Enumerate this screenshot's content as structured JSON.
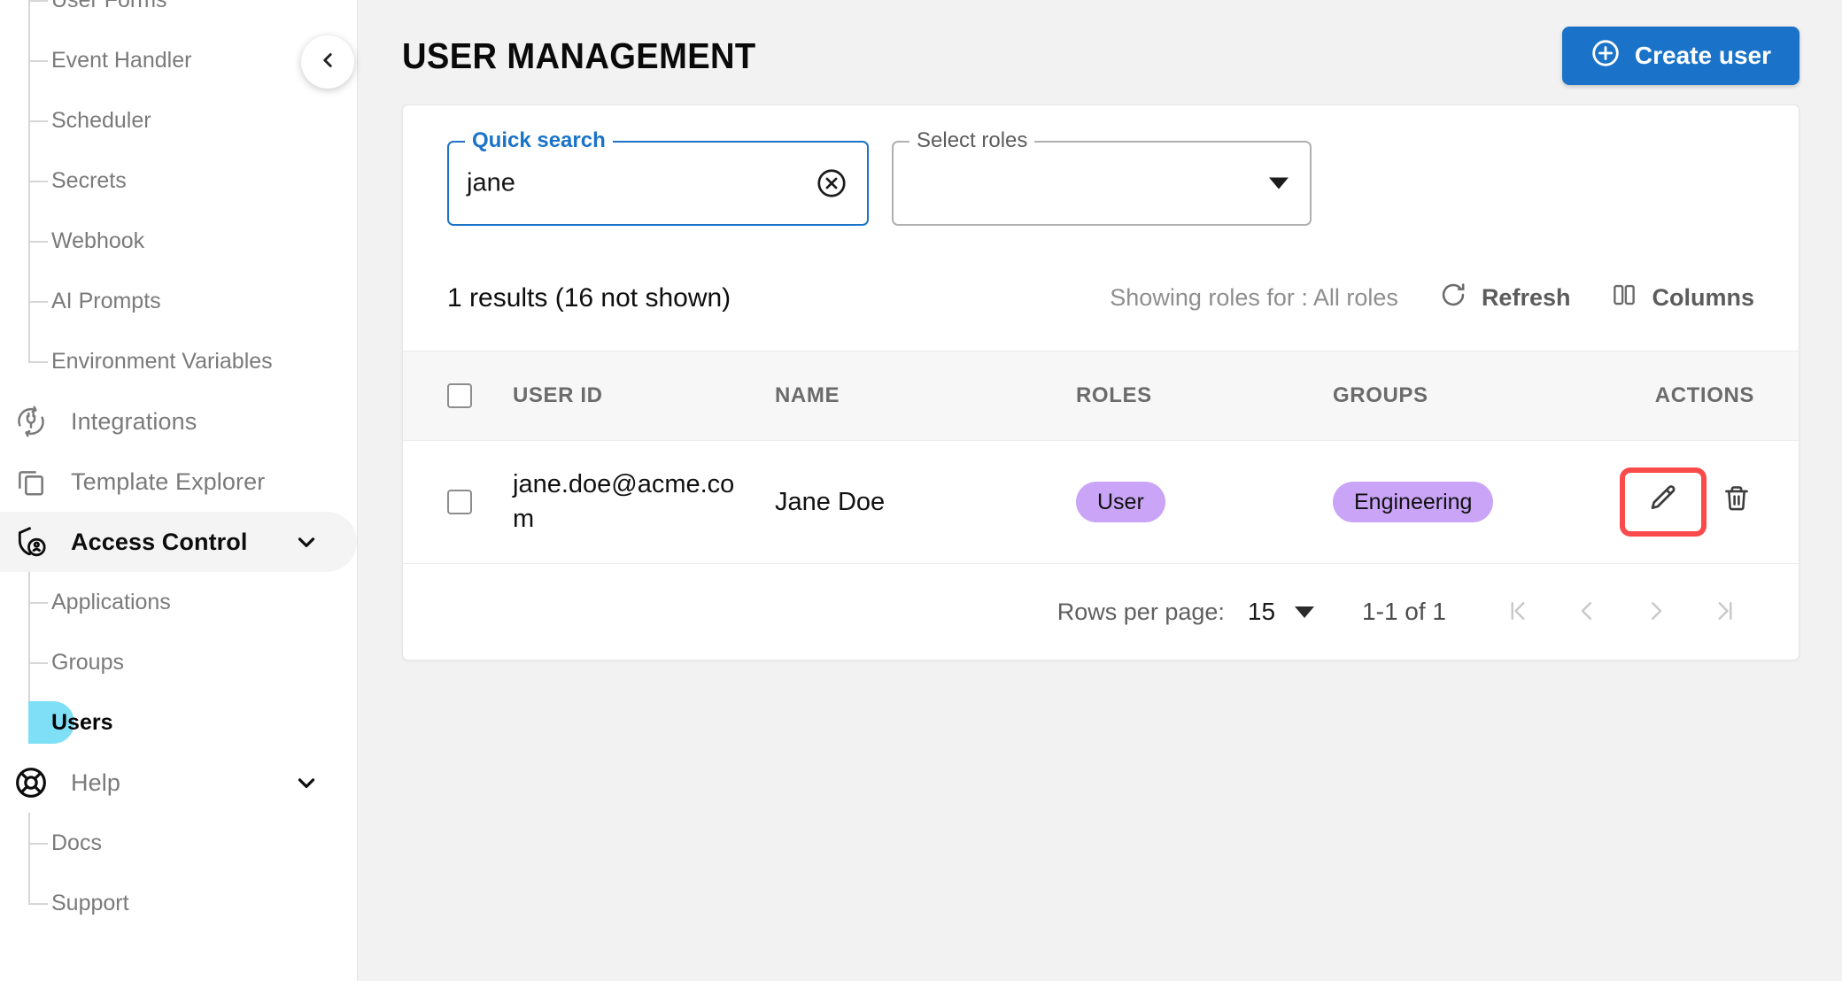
{
  "sidebar": {
    "collapse_button_icon": "chevron-left-icon",
    "items": [
      {
        "label": "User Forms",
        "type": "child",
        "state": "normal",
        "partial": true
      },
      {
        "label": "Event Handler",
        "type": "child",
        "state": "normal"
      },
      {
        "label": "Scheduler",
        "type": "child",
        "state": "normal"
      },
      {
        "label": "Secrets",
        "type": "child",
        "state": "normal"
      },
      {
        "label": "Webhook",
        "type": "child",
        "state": "normal"
      },
      {
        "label": "AI Prompts",
        "type": "child",
        "state": "normal"
      },
      {
        "label": "Environment Variables",
        "type": "child",
        "state": "normal",
        "last": true
      },
      {
        "label": "Integrations",
        "type": "top",
        "icon": "plug-sync-icon",
        "state": "normal"
      },
      {
        "label": "Template Explorer",
        "type": "top",
        "icon": "copy-stack-icon",
        "state": "normal"
      },
      {
        "label": "Access Control",
        "type": "top",
        "icon": "shield-user-icon",
        "state": "expanded-active",
        "chevron": "chevron-down-icon"
      },
      {
        "label": "Applications",
        "type": "child",
        "state": "normal"
      },
      {
        "label": "Groups",
        "type": "child",
        "state": "normal"
      },
      {
        "label": "Users",
        "type": "child",
        "state": "selected",
        "last": true
      },
      {
        "label": "Help",
        "type": "top",
        "icon": "lifebuoy-icon",
        "state": "expanded",
        "chevron": "chevron-down-icon"
      },
      {
        "label": "Docs",
        "type": "child",
        "state": "normal"
      },
      {
        "label": "Support",
        "type": "child",
        "state": "normal",
        "last": true
      }
    ],
    "selected_pill_color": "#7fdff7",
    "active_parent_bg": "#f4f4f4"
  },
  "header": {
    "title": "USER MANAGEMENT",
    "create_user_label": "Create user",
    "create_user_icon": "plus-circle-icon",
    "create_user_color": "#1a73c8"
  },
  "filters": {
    "quick_search": {
      "legend": "Quick search",
      "value": "jane",
      "placeholder": "",
      "focused": true,
      "clear_icon": "clear-circle-icon",
      "focus_color": "#1a73c8"
    },
    "select_roles": {
      "legend": "Select roles",
      "value": "",
      "caret_icon": "caret-down-icon"
    }
  },
  "toolbar": {
    "results_count": "1 results (16 not shown)",
    "showing_roles": "Showing roles for : All roles",
    "refresh_label": "Refresh",
    "refresh_icon": "refresh-icon",
    "columns_label": "Columns",
    "columns_icon": "columns-icon"
  },
  "table": {
    "columns": [
      "USER ID",
      "NAME",
      "ROLES",
      "GROUPS",
      "ACTIONS"
    ],
    "select_all_checked": false,
    "rows": [
      {
        "checked": false,
        "user_id": "jane.doe@acme.com",
        "name": "Jane Doe",
        "roles": [
          "User"
        ],
        "groups": [
          "Engineering"
        ],
        "actions": {
          "edit_icon": "pencil-edit-icon",
          "edit_highlighted": true,
          "highlight_color": "#fa4a4a",
          "delete_icon": "trash-icon"
        }
      }
    ],
    "chip_color": "#c9a4f7"
  },
  "pagination": {
    "rows_per_page_label": "Rows per page:",
    "rows_per_page_value": "15",
    "range_label": "1-1 of 1",
    "first_page_icon": "first-page-icon",
    "prev_page_icon": "prev-page-icon",
    "next_page_icon": "next-page-icon",
    "last_page_icon": "last-page-icon",
    "nav_disabled": true
  }
}
